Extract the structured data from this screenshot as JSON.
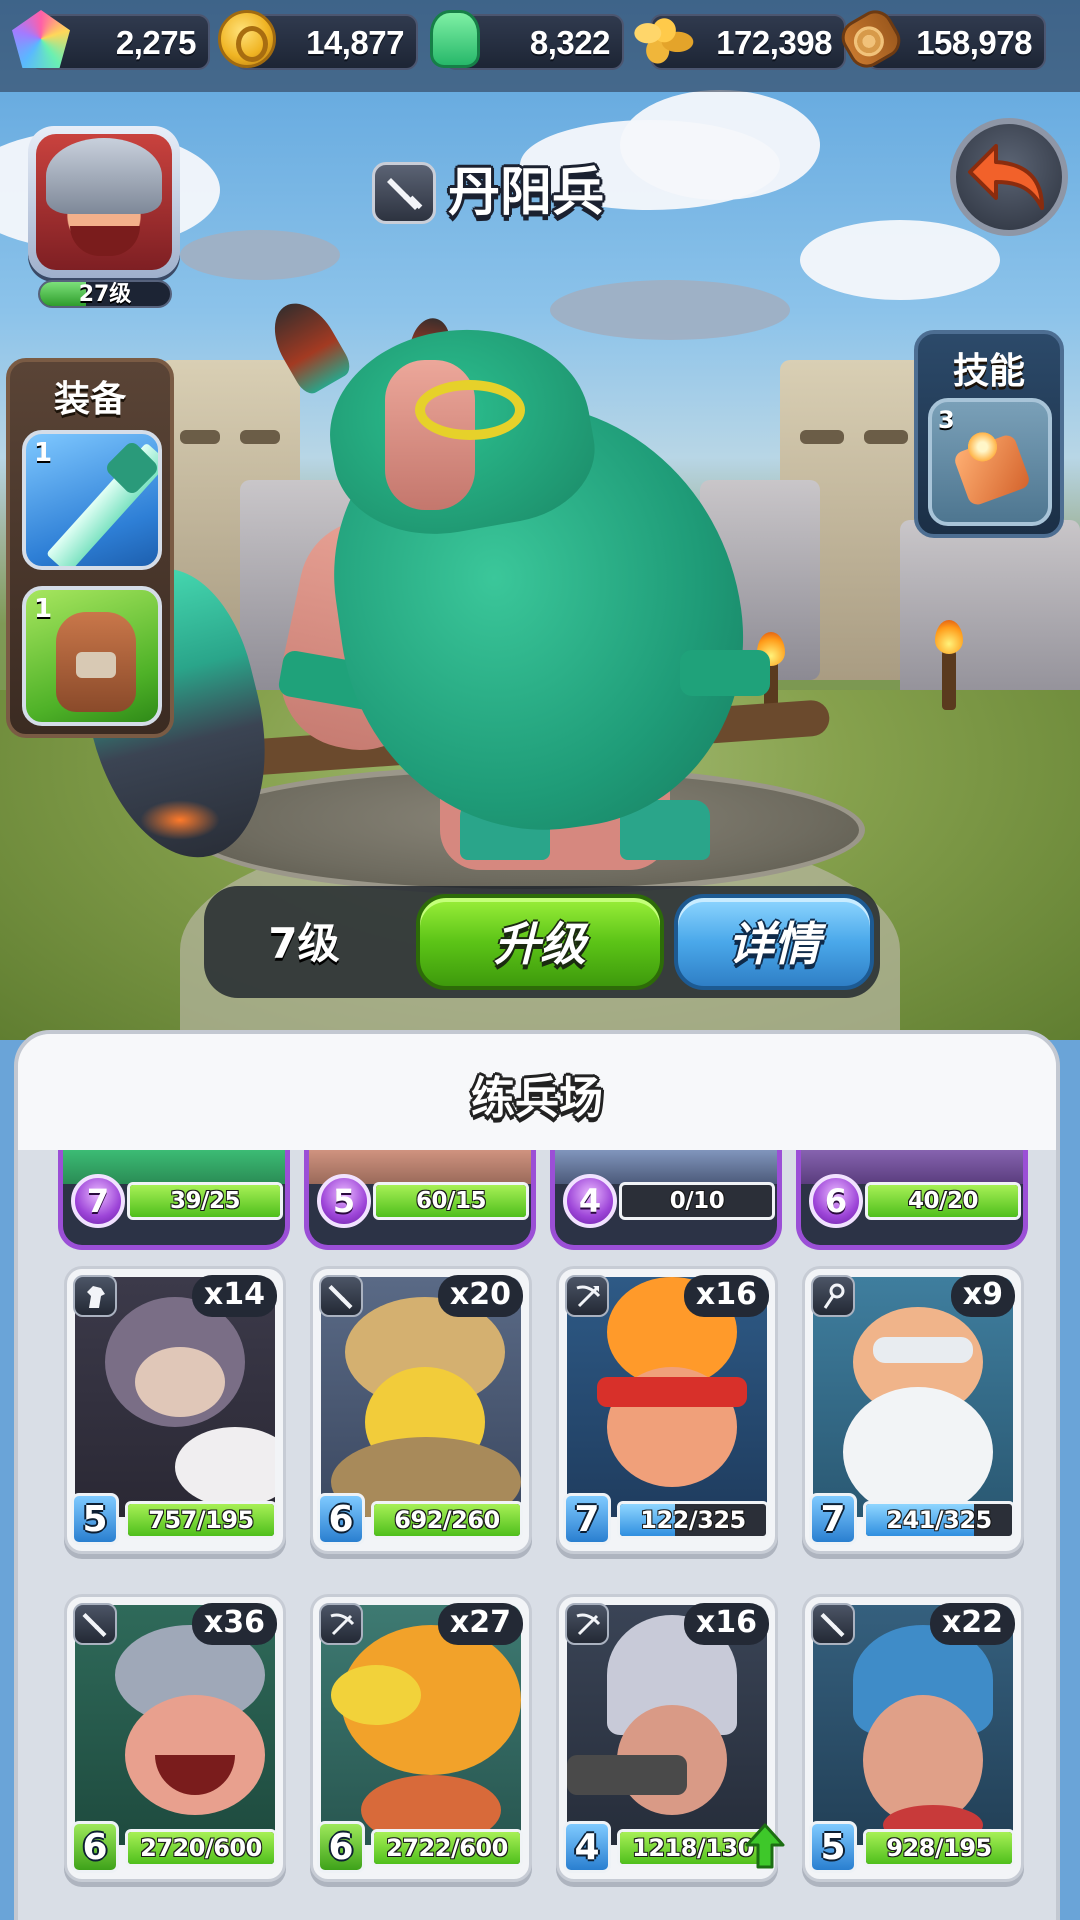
{
  "resources": [
    {
      "icon": "gem-icon",
      "value": "2,275"
    },
    {
      "icon": "coin-icon",
      "value": "14,877"
    },
    {
      "icon": "jade-icon",
      "value": "8,322"
    },
    {
      "icon": "wheat-icon",
      "value": "172,398"
    },
    {
      "icon": "wood-icon",
      "value": "158,978"
    }
  ],
  "player": {
    "level_label": "27级",
    "xp_progress": 0.35
  },
  "unit": {
    "name": "丹阳兵",
    "class_icon": "sword-icon",
    "level_label": "7级"
  },
  "buttons": {
    "upgrade": "升级",
    "details": "详情"
  },
  "equipment": {
    "title": "装备",
    "items": [
      {
        "icon": "jade-sword-icon",
        "count": "1"
      },
      {
        "icon": "leather-armor-icon",
        "count": "1"
      }
    ]
  },
  "skills": {
    "title": "技能",
    "items": [
      {
        "icon": "fire-scroll-icon",
        "count": "3"
      }
    ]
  },
  "barracks": {
    "title": "练兵场",
    "partial_row": [
      {
        "level": "7",
        "progress": "39/25",
        "fill": 1.0,
        "bar": "green"
      },
      {
        "level": "5",
        "progress": "60/15",
        "fill": 1.0,
        "bar": "green"
      },
      {
        "level": "4",
        "progress": "0/10",
        "fill": 0.0,
        "bar": "green"
      },
      {
        "level": "6",
        "progress": "40/20",
        "fill": 1.0,
        "bar": "green"
      }
    ],
    "units": [
      {
        "class_icon": "horse-icon",
        "qty": "x14",
        "level": "5",
        "level_color": "blue",
        "progress": "757/195",
        "fill": 1.0,
        "bar": "green"
      },
      {
        "class_icon": "sword-icon",
        "qty": "x20",
        "level": "6",
        "level_color": "blue",
        "progress": "692/260",
        "fill": 1.0,
        "bar": "green"
      },
      {
        "class_icon": "crossbow-icon",
        "qty": "x16",
        "level": "7",
        "level_color": "blue",
        "progress": "122/325",
        "fill": 0.38,
        "bar": "blue"
      },
      {
        "class_icon": "staff-icon",
        "qty": "x9",
        "level": "7",
        "level_color": "blue",
        "progress": "241/325",
        "fill": 0.74,
        "bar": "blue"
      },
      {
        "class_icon": "sword-icon",
        "qty": "x36",
        "level": "6",
        "level_color": "green",
        "progress": "2720/600",
        "fill": 1.0,
        "bar": "green"
      },
      {
        "class_icon": "crossbow-icon",
        "qty": "x27",
        "level": "6",
        "level_color": "green",
        "progress": "2722/600",
        "fill": 1.0,
        "bar": "green"
      },
      {
        "class_icon": "crossbow-icon",
        "qty": "x16",
        "level": "4",
        "level_color": "blue",
        "progress": "1218/130",
        "fill": 1.0,
        "bar": "green",
        "upgrade_arrow": true
      },
      {
        "class_icon": "sword-icon",
        "qty": "x22",
        "level": "5",
        "level_color": "blue",
        "progress": "928/195",
        "fill": 1.0,
        "bar": "green"
      }
    ]
  }
}
